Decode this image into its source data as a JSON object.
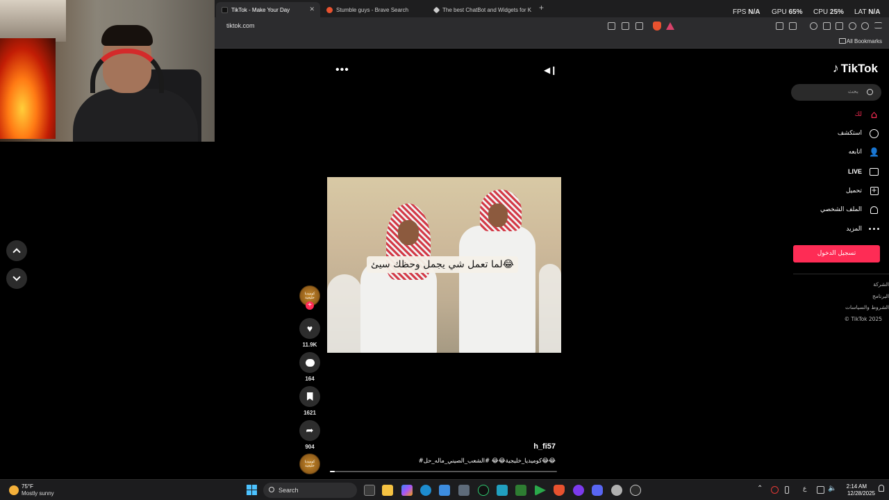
{
  "browser": {
    "tabs": [
      {
        "label": "TikTok - Make Your Day",
        "active": true
      },
      {
        "label": "Stumble guys - Brave Search",
        "active": false
      },
      {
        "label": "The best ChatBot and Widgets for K",
        "active": false
      }
    ],
    "url": "tiktok.com",
    "bookmarks_label": "All Bookmarks",
    "perf": {
      "fps_label": "FPS",
      "fps_value": "N/A",
      "gpu_label": "GPU",
      "gpu_value": "65",
      "cpu_label": "CPU",
      "cpu_value": "25",
      "lat_label": "LAT",
      "lat_value": "N/A"
    }
  },
  "video": {
    "caption_overlay": "لما تعمل شي يجمل وحظك سيئ😂",
    "username": "h_fi57",
    "hashtags": "#كوميديا_خليجية😂😂 #الشعب_الصيني_ماله_حل😂😂",
    "creator_avatar_text": "كوميديا خليجية",
    "actions": {
      "likes": "11.9K",
      "comments": "164",
      "saves": "1621",
      "shares": "904"
    },
    "progress": 0.02
  },
  "sidebar": {
    "logo": "TikTok",
    "search_placeholder": "بحث",
    "nav": [
      {
        "label": "لك",
        "icon": "home-icon",
        "active": true
      },
      {
        "label": "استكشف",
        "icon": "compass-icon",
        "active": false
      },
      {
        "label": "اتابعه",
        "icon": "following-icon",
        "active": false
      },
      {
        "label": "LIVE",
        "icon": "live-icon",
        "active": false
      },
      {
        "label": "تحميل",
        "icon": "upload-icon",
        "active": false
      },
      {
        "label": "الملف الشخصي",
        "icon": "profile-icon",
        "active": false
      },
      {
        "label": "المزيد",
        "icon": "more-icon",
        "active": false
      }
    ],
    "login_label": "تسجيل الدخول",
    "footer": [
      "الشركة",
      "البرنامج",
      "الشروط والسياسات",
      "© TikTok 2025"
    ]
  },
  "taskbar": {
    "weather_temp": "75°F",
    "weather_desc": "Mostly sunny",
    "search_label": "Search",
    "clock_time": "2:14 AM",
    "clock_date": "12/28/2025",
    "lang": "ع"
  },
  "colors": {
    "accent": "#fe2c55",
    "chrome_bg": "#2c2c2e",
    "page_bg": "#000000"
  }
}
